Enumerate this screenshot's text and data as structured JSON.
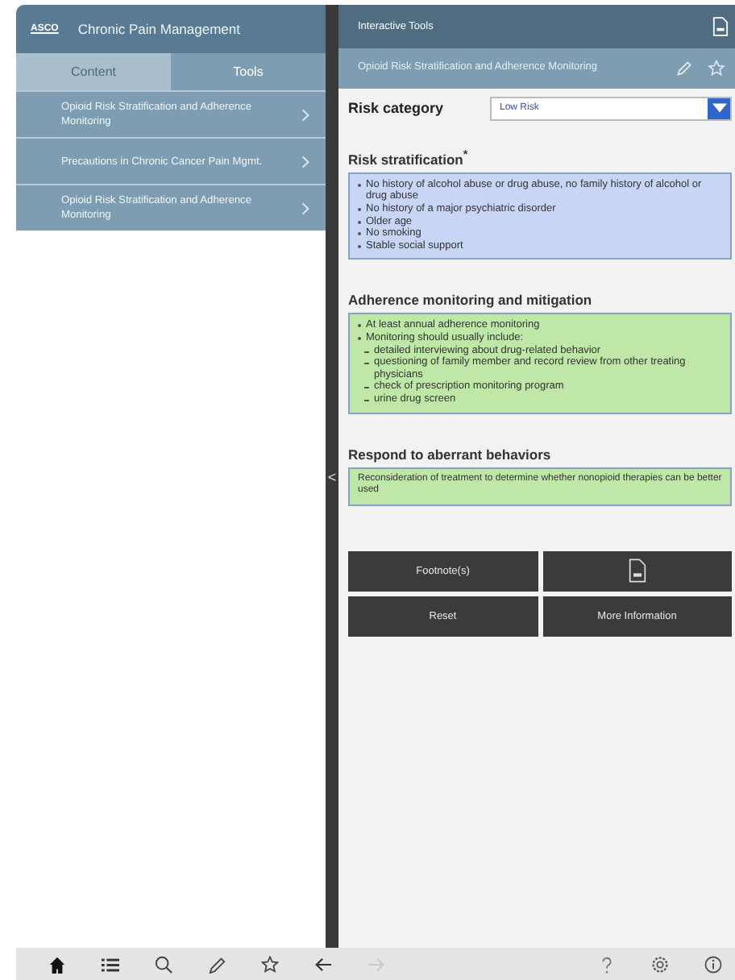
{
  "left_panel": {
    "logo": "ASCO",
    "title": "Chronic Pain Management",
    "tabs": [
      {
        "label": "Content",
        "selected": false
      },
      {
        "label": "Tools",
        "selected": true
      }
    ],
    "items": [
      {
        "title": "Opioid Risk Stratification and Adherence Monitoring"
      },
      {
        "title": "Precautions in Chronic Cancer Pain Mgmt."
      },
      {
        "title": "Opioid Risk Stratification and Adherence Monitoring"
      }
    ]
  },
  "collapse_handle": "<",
  "right_panel": {
    "title": "Interactive Tools",
    "subtitle": "Opioid Risk Stratification and Adherence Monitoring",
    "risk_category": {
      "label": "Risk category",
      "value": "Low Risk"
    },
    "sections": [
      {
        "heading": "Risk stratification$^{*}$",
        "color": "#c9d5f5",
        "lines": [
          {
            "text": "No history of alcohol abuse or drug abuse, no family history of alcohol or drug abuse"
          },
          {
            "text": "No history of a major psychiatric disorder"
          },
          {
            "text": "Older age"
          },
          {
            "text": "No smoking"
          },
          {
            "text": "Stable social support"
          }
        ]
      },
      {
        "heading": "Adherence monitoring and mitigation",
        "color": "#bfe8a8",
        "lines": [
          {
            "text": "At least annual adherence monitoring"
          },
          {
            "text": "Monitoring should usually include:",
            "children": [
              {
                "text": "detailed interviewing about drug-related behavior"
              },
              {
                "text": "questioning of family member and record review from other treating physicians"
              },
              {
                "text": "check of prescription monitoring program"
              },
              {
                "text": "urine drug screen"
              }
            ]
          }
        ]
      },
      {
        "heading": "Respond to aberrant behaviors",
        "color": "#bfe8a8",
        "paragraph": "Reconsideration of treatment to determine whether nonopioid therapies can be better used"
      }
    ],
    "buttons": [
      {
        "kind": "text",
        "label": "Footnote(s)"
      },
      {
        "kind": "document"
      },
      {
        "kind": "text",
        "label": "Reset"
      },
      {
        "kind": "text",
        "label": "More Information"
      }
    ]
  },
  "toolbar": [
    {
      "kind": "home",
      "disabled": false
    },
    {
      "kind": "list",
      "disabled": false
    },
    {
      "kind": "search",
      "disabled": false
    },
    {
      "kind": "pencil",
      "disabled": false
    },
    {
      "kind": "star",
      "disabled": false
    },
    {
      "kind": "back",
      "disabled": false
    },
    {
      "kind": "forward",
      "disabled": true
    },
    {
      "kind": "help",
      "disabled": false
    },
    {
      "kind": "settings",
      "disabled": false
    },
    {
      "kind": "info",
      "disabled": false
    }
  ]
}
